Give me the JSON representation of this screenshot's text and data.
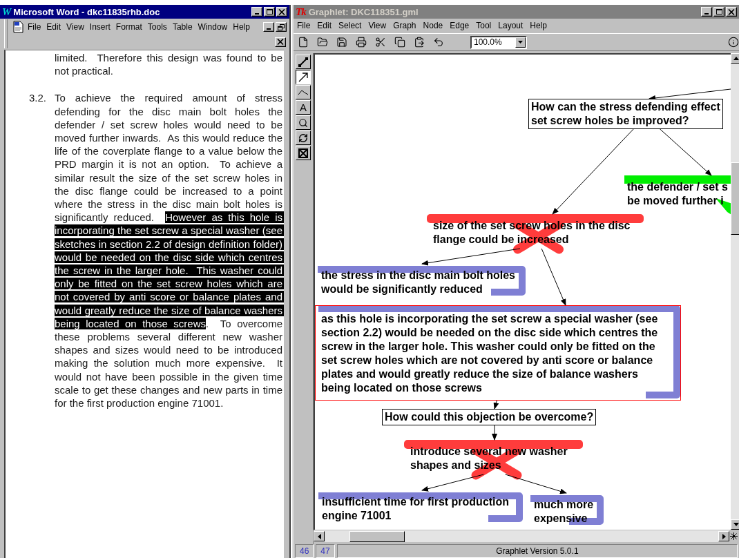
{
  "word": {
    "badge": "W",
    "title": "Microsoft Word - dkc11835rhb.doc",
    "menu": [
      "File",
      "Edit",
      "View",
      "Insert",
      "Format",
      "Tools",
      "Table",
      "Window",
      "Help"
    ],
    "paragraphs": [
      {
        "segments": [
          {
            "text": "limited.  Therefore this design was found to be not practical.",
            "selected": false
          }
        ]
      },
      {
        "number": "3.2.",
        "segments": [
          {
            "text": "To achieve the required amount of stress defending for the disc main bolt holes the defender / set screw holes would need to be moved further inwards.  As this would reduce the life of the coverplate flange to a value below the PRD margin it is not an option.  To achieve a similar result the size of the set screw holes in the disc flange could be increased to a point where the stress in the disc main bolt holes is significantly reduced.  ",
            "selected": false
          },
          {
            "text": "However as this hole is incorporating the set screw a special washer (see sketches in section 2.2 of design definition folder) would be needed on the disc side which centres the screw in the larger hole.  This washer could only be fitted on the set screw holes which are not covered by anti score or balance plates and would greatly reduce the size of balance washers being located on those screws",
            "selected": true
          },
          {
            "text": ".  To overcome these problems several different new washer shapes and sizes would need to be introduced making the solution much more expensive.  It would not have been possible in the given time scale to get these changes and new parts in time for the first production engine 71001.",
            "selected": false
          }
        ]
      }
    ]
  },
  "graphlet": {
    "badge": "Tk",
    "title": "Graphlet: DKC118351.gml",
    "menu": [
      "File",
      "Edit",
      "Select",
      "View",
      "Graph",
      "Node",
      "Edge",
      "Tool",
      "Layout",
      "Help"
    ],
    "zoom": "100.0%",
    "tools": [
      {
        "kind": "resize",
        "selected": false
      },
      {
        "kind": "edge",
        "selected": true
      },
      {
        "kind": "curve",
        "selected": false
      },
      {
        "kind": "text",
        "label": "A",
        "selected": false
      },
      {
        "kind": "zoom",
        "selected": false
      },
      {
        "kind": "rotate",
        "selected": false
      },
      {
        "kind": "fit",
        "selected": false
      }
    ],
    "graph": {
      "kind": "question",
      "offscreen_parent": true,
      "selected": false,
      "lines": [
        "How can the stress defending effect",
        "set screw holes be improved?"
      ],
      "children": [
        {
          "kind": "accepted",
          "color": "#00ee00",
          "selected": false,
          "lines": [
            "the defender / set s",
            "be moved further i"
          ]
        },
        {
          "kind": "rejected",
          "color": "#ff3c3c",
          "selected": false,
          "lines": [
            "size of the set screw holes in the disc",
            "flange could be increased"
          ],
          "children": [
            {
              "kind": "argument",
              "color": "#7f7fd4",
              "selected": false,
              "lines": [
                "the stress in the disc main bolt holes",
                "would be significantly reduced"
              ]
            },
            {
              "kind": "argument",
              "color": "#7f7fd4",
              "selected": true,
              "lines": [
                "as this hole is incorporating the set screw a special washer (see",
                "section 2.2) would be needed on the disc side which centres the",
                "screw in the larger hole. This washer could only be fitted on the",
                "set screw holes which are not covered by anti score or balance",
                "plates and would greatly reduce the size of balance washers",
                "being located on those screws"
              ],
              "children": [
                {
                  "kind": "question",
                  "selected": false,
                  "lines": [
                    "How could this objection be overcome?"
                  ],
                  "children": [
                    {
                      "kind": "rejected",
                      "color": "#ff3c3c",
                      "selected": false,
                      "lines": [
                        "introduce several new washer",
                        "shapes and sizes"
                      ],
                      "children": [
                        {
                          "kind": "argument",
                          "color": "#7f7fd4",
                          "selected": false,
                          "lines": [
                            "insufficient time for first production",
                            "engine 71001"
                          ]
                        },
                        {
                          "kind": "argument",
                          "color": "#7f7fd4",
                          "selected": false,
                          "lines": [
                            "much more",
                            "expensive"
                          ]
                        }
                      ]
                    }
                  ]
                }
              ]
            }
          ]
        }
      ]
    },
    "status_cells": [
      "46",
      "47"
    ],
    "version": "Graphlet Version 5.0.1"
  }
}
